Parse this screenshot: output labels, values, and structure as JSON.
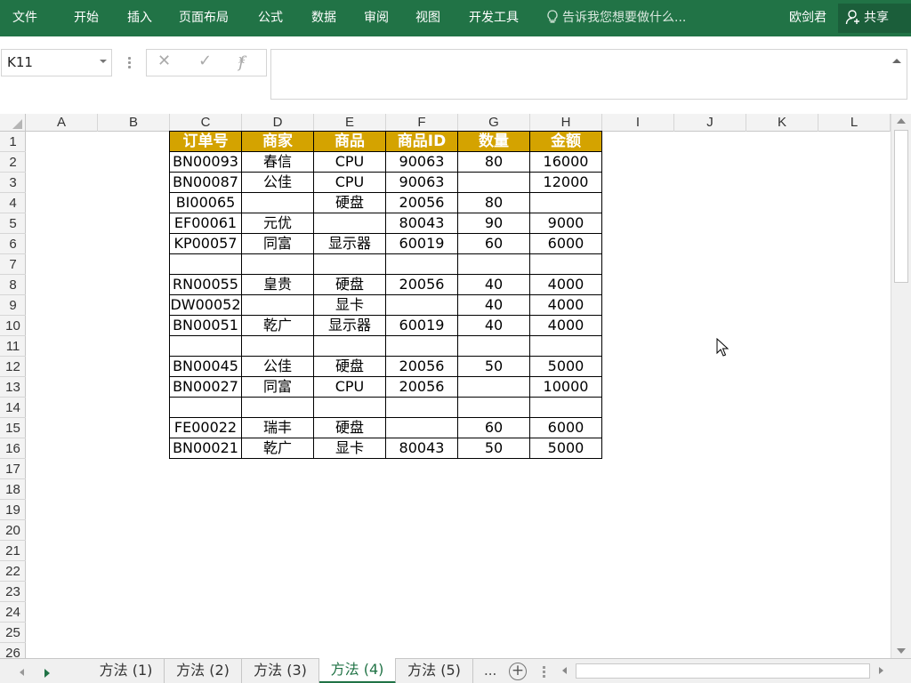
{
  "ribbon": {
    "tabs": [
      "文件",
      "开始",
      "插入",
      "页面布局",
      "公式",
      "数据",
      "审阅",
      "视图",
      "开发工具"
    ],
    "tell_me": "告诉我您想要做什么...",
    "user": "欧剑君",
    "share": "共享"
  },
  "formula_bar": {
    "name_box": "K11",
    "cancel_symbol": "✕",
    "enter_symbol": "✓",
    "fx_symbol": "fx",
    "content": ""
  },
  "columns": [
    "A",
    "B",
    "C",
    "D",
    "E",
    "F",
    "G",
    "H",
    "I",
    "J",
    "K",
    "L"
  ],
  "rows": [
    "1",
    "2",
    "3",
    "4",
    "5",
    "6",
    "7",
    "8",
    "9",
    "10",
    "11",
    "12",
    "13",
    "14",
    "15",
    "16",
    "17",
    "18",
    "19",
    "20",
    "21",
    "22",
    "23",
    "24",
    "25",
    "26"
  ],
  "table": {
    "headers": [
      "订单号",
      "商家",
      "商品",
      "商品ID",
      "数量",
      "金额"
    ],
    "rows": [
      [
        "BN00093",
        "春信",
        "CPU",
        "90063",
        "80",
        "16000"
      ],
      [
        "BN00087",
        "公佳",
        "CPU",
        "90063",
        "",
        "12000"
      ],
      [
        "BI00065",
        "",
        "硬盘",
        "20056",
        "80",
        ""
      ],
      [
        "EF00061",
        "元优",
        "",
        "80043",
        "90",
        "9000"
      ],
      [
        "KP00057",
        "同富",
        "显示器",
        "60019",
        "60",
        "6000"
      ],
      [
        "",
        "",
        "",
        "",
        "",
        ""
      ],
      [
        "RN00055",
        "皇贵",
        "硬盘",
        "20056",
        "40",
        "4000"
      ],
      [
        "DW00052",
        "",
        "显卡",
        "",
        "40",
        "4000"
      ],
      [
        "BN00051",
        "乾广",
        "显示器",
        "60019",
        "40",
        "4000"
      ],
      [
        "",
        "",
        "",
        "",
        "",
        ""
      ],
      [
        "BN00045",
        "公佳",
        "硬盘",
        "20056",
        "50",
        "5000"
      ],
      [
        "BN00027",
        "同富",
        "CPU",
        "20056",
        "",
        "10000"
      ],
      [
        "",
        "",
        "",
        "",
        "",
        ""
      ],
      [
        "FE00022",
        "瑞丰",
        "硬盘",
        "",
        "60",
        "6000"
      ],
      [
        "BN00021",
        "乾广",
        "显卡",
        "80043",
        "50",
        "5000"
      ]
    ],
    "header_color": "#D4A300"
  },
  "sheets": {
    "tabs": [
      "方法 (1)",
      "方法 (2)",
      "方法 (3)",
      "方法 (4)",
      "方法 (5)"
    ],
    "active_index": 3,
    "more": "...",
    "add": "+"
  },
  "colors": {
    "ribbon": "#217346"
  }
}
